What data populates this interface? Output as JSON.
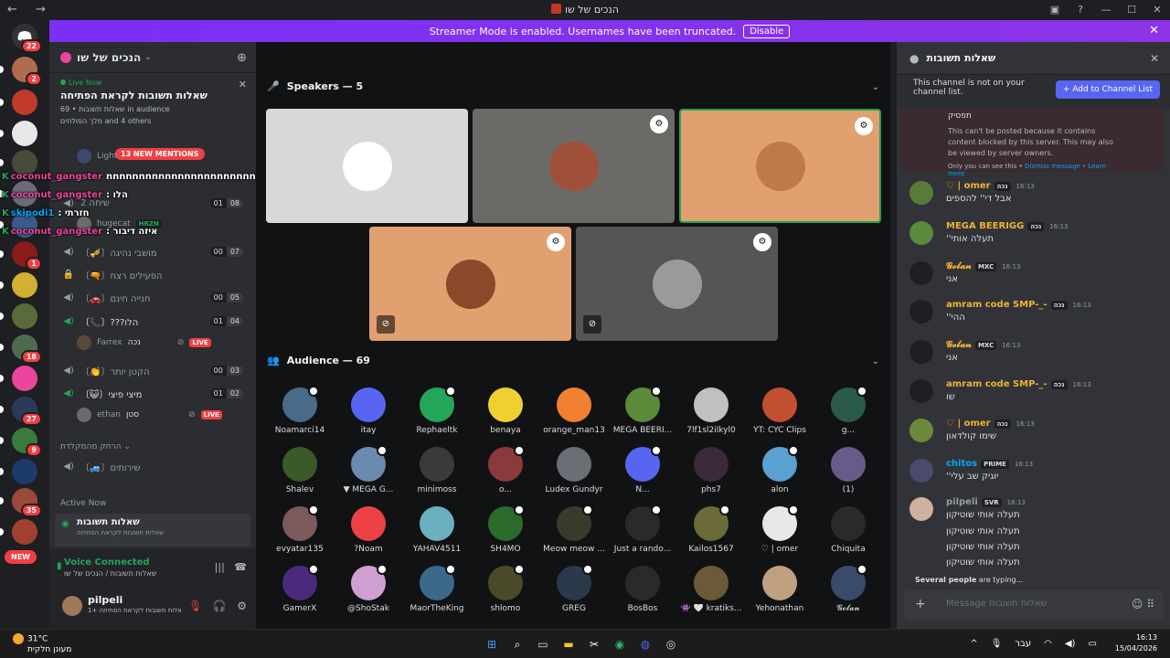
{
  "window": {
    "title": "הנכים של שו",
    "back": "←",
    "forward": "→"
  },
  "banner": {
    "text": "Streamer Mode is enabled. Usernames have been truncated.",
    "button": "Disable",
    "close": "✕"
  },
  "guilds": {
    "home_badge": "22",
    "badges": [
      "2",
      "1",
      "18",
      "27",
      "9",
      "35",
      "1"
    ],
    "new_label": "NEW"
  },
  "server": {
    "name": "הנכים של שו",
    "live": {
      "tag": "Live Now",
      "title": "שאלות תשובות לקראת הפתיחה",
      "channel": "שאלות תשובות",
      "audience": "69 in audience",
      "others": "מלך הפולחים and 4 others"
    },
    "mentions_pill": "13 NEW MENTIONS",
    "channels": [
      {
        "icon": "speaker",
        "name": "שיחה 2 ",
        "counts": [
          "01",
          "08"
        ]
      },
      {
        "icon": "speaker",
        "name": "〔🎺〕מושבי נהיגה",
        "counts": [
          "00",
          "07"
        ]
      },
      {
        "icon": "lock",
        "name": "〔🔫〕הפעילים רצח",
        "counts": []
      },
      {
        "icon": "speaker",
        "name": "〔🚗〕חנייה חינם",
        "counts": [
          "00",
          "05"
        ]
      },
      {
        "icon": "speaker-on",
        "name": "〔📞〕???הלו",
        "counts": [
          "01",
          "04"
        ]
      },
      {
        "icon": "speaker",
        "name": "〔👏〕הקטן יותר",
        "counts": [
          "00",
          "03"
        ]
      },
      {
        "icon": "speaker-on",
        "name": "〔😺〕מיצי פיצי",
        "counts": [
          "01",
          "02"
        ]
      },
      {
        "icon": "speaker",
        "name": "〔🚙〕שירותים",
        "counts": []
      }
    ],
    "members": [
      {
        "name": "Light",
        "badge": ""
      },
      {
        "name": "hugecat",
        "badge": "HRZN"
      },
      {
        "name": "Farrex",
        "badge": "נכה",
        "live": "LIVE"
      },
      {
        "name": "ethan",
        "badge": "סטן",
        "live": "LIVE"
      }
    ],
    "category_afk": "הרחק מהמקלדת",
    "active_now_label": "Active Now",
    "active_card": {
      "title": "שאלות תשובות",
      "subtitle": "שאלות תשובות לקראת הפתיחה"
    }
  },
  "voice": {
    "status": "Voice Connected",
    "sub": "שאלות תשובות / הנכים של שו"
  },
  "user": {
    "name": "pilpeli",
    "status": "אלות תשובות לקראת הפתיחה +1"
  },
  "overlay": [
    {
      "k": "K",
      "name": "coconut_gangster",
      "msg": "nnnnnnnnnnnnnnnnnnnnnnnnnnnnnnnnnnnnnnnnnnnnnnnnnnnnnnn"
    },
    {
      "k": "K",
      "name": "coconut_gangster",
      "msg": ": הלו"
    },
    {
      "k": "K",
      "name": "skipodi1",
      "msg": ": חזרתי"
    },
    {
      "k": "K",
      "name": "coconut_gangster",
      "msg": ": איזה דיבור"
    }
  ],
  "stage": {
    "speakers_label": "Speakers — 5",
    "audience_label": "Audience — 69",
    "audience": [
      "Noamarci14",
      "itay",
      "Rephaeltk",
      "benaya",
      "orange_man13",
      "MEGA BEERI...",
      "7lf1sl2ilkyl0",
      "YT: CYC Clips",
      "g...",
      "Shalev",
      "▼ MEGA G...",
      "minimoss",
      "o...",
      "Ludex Gundyr",
      "N...",
      "phs7",
      "alon",
      "(1)",
      "evyatar135",
      "?Noam",
      "YAHAV4511",
      "SH4MO",
      "Meow meow ...",
      "Just a rando...",
      "Kailos1567",
      "♡ | omer",
      "Chiquita",
      "GamerX",
      "@ShoStak",
      "MaorTheKing",
      "shlomo",
      "GREG",
      "BosBos",
      "👾 🤍 kratiks...",
      "Yehonathan",
      "𝓖𝓸𝓵𝓪𝓷"
    ]
  },
  "chat": {
    "title": "שאלות תשובות",
    "notice": "This channel is not on your channel list.",
    "notice_button": "+ Add to Channel List",
    "blocked": {
      "prev_text": "תפסיק",
      "body": "This can't be posted because it contains content blocked by this server. This may also be viewed by server owners.",
      "only_you": "Only you can see this •",
      "dismiss": "Dismiss message",
      "learn": "• Learn more"
    },
    "messages": [
      {
        "name": "♡ | omer",
        "tag": "נכה",
        "time": "16:13",
        "text": "אבל די'' להספים",
        "color": "#f0b232"
      },
      {
        "name": "MEGA BEERIGG",
        "tag": "נכה",
        "time": "16:13",
        "text": "תעלה אותי''",
        "color": "#f0b232"
      },
      {
        "name": "𝓖𝓸𝓵𝓪𝓷",
        "tag": "MXC",
        "time": "16:13",
        "text": "אני",
        "color": "#f0b232"
      },
      {
        "name": "amram code SMP-_-",
        "tag": "נכה",
        "time": "16:13",
        "text": "ההי''",
        "color": "#f0b232"
      },
      {
        "name": "𝓖𝓸𝓵𝓪𝓷",
        "tag": "MXC",
        "time": "16:13",
        "text": "אני",
        "color": "#f0b232"
      },
      {
        "name": "amram code SMP-_-",
        "tag": "נכה",
        "time": "16:13",
        "text": "שו",
        "color": "#f0b232"
      },
      {
        "name": "♡ | omer",
        "tag": "נכה",
        "time": "16:13",
        "text": "שימו קולדאון",
        "color": "#f0b232"
      },
      {
        "name": "chitos",
        "tag": "PRIME",
        "time": "16:13",
        "text": "יוגיק שב עלי''",
        "color": "#00a8fc"
      },
      {
        "name": "pilpeli",
        "tag": "SVR",
        "time": "16:13",
        "text": "תעלה אותי שוטיקון",
        "color": "#949ba4"
      }
    ],
    "extra_lines": [
      "תעלה אותי שוטיקון",
      "תעלה אותי שוטיקון",
      "תעלה אותי שוטיקון"
    ],
    "typing_who": "Several people",
    "typing_rest": "are typing...",
    "placeholder": "Message שאלות תשובות"
  },
  "taskbar": {
    "temp": "31°C",
    "weather": "מעונן חלקית",
    "lang": "עבר",
    "time": "16:13",
    "date": "15/04/2026"
  }
}
